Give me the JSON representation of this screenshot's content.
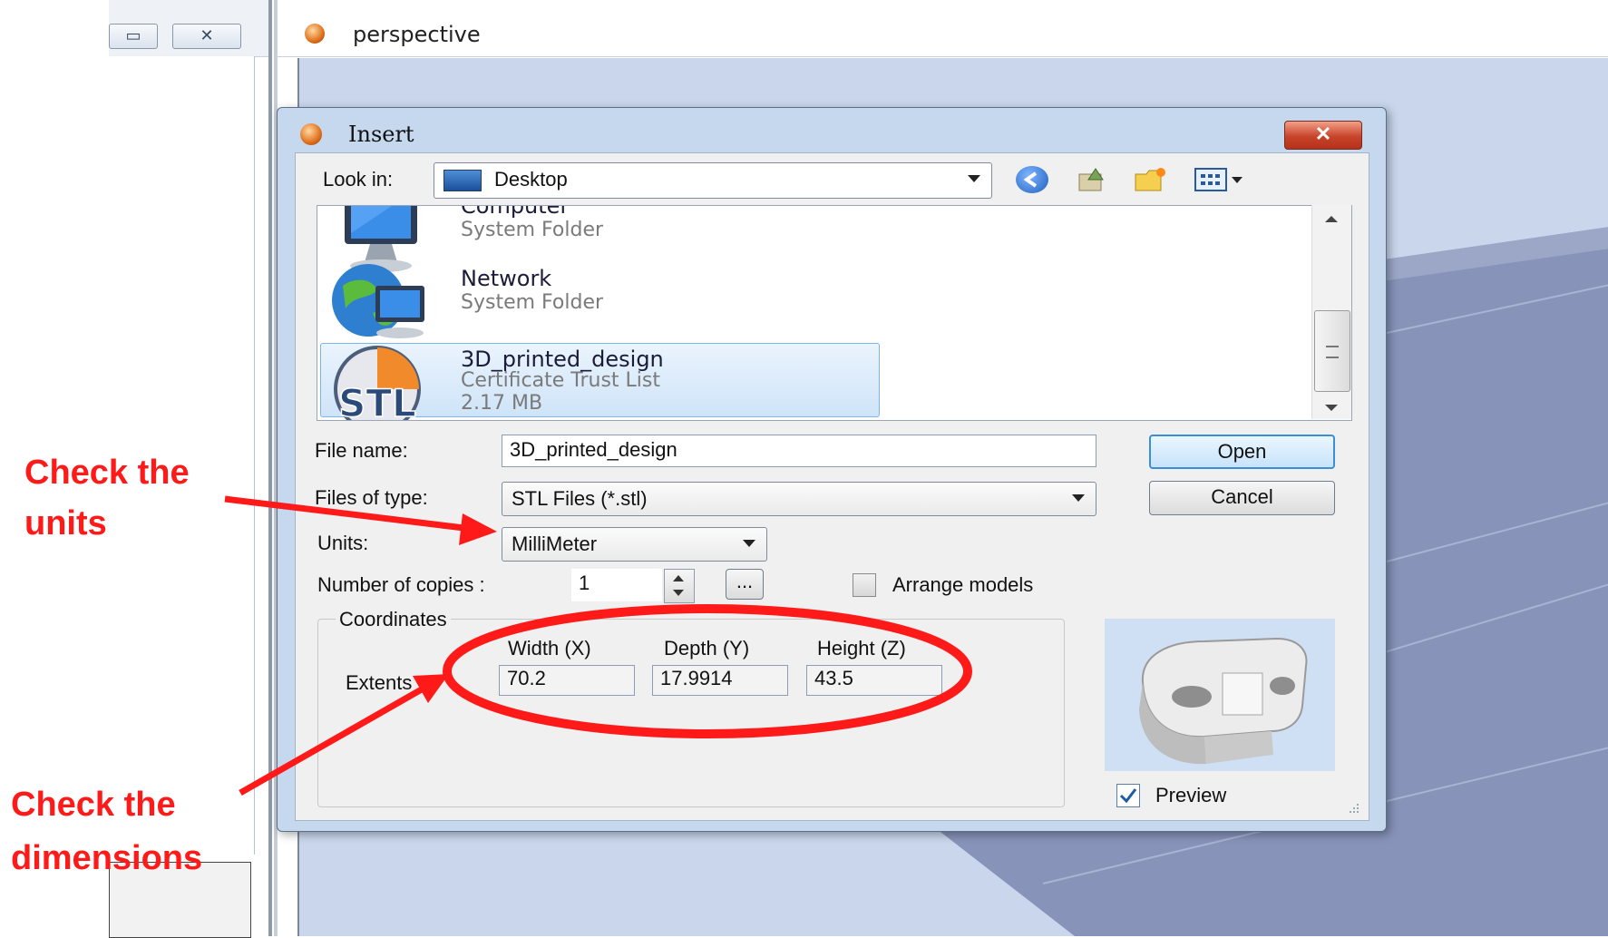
{
  "viewport": {
    "title": "perspective"
  },
  "left_window": {
    "restore_glyph": "▭",
    "close_glyph": "✕"
  },
  "dialog": {
    "title": "Insert",
    "close_glyph": "✕",
    "look_in_label": "Look in:",
    "look_in_value": "Desktop",
    "files": [
      {
        "name": "Computer",
        "type": "System Folder",
        "size": "",
        "icon": "computer-icon"
      },
      {
        "name": "Network",
        "type": "System Folder",
        "size": "",
        "icon": "network-globe-icon"
      },
      {
        "name": "3D_printed_design",
        "type": "Certificate Trust List",
        "size": "2.17 MB",
        "icon": "stl-file-icon",
        "selected": true
      }
    ],
    "file_name_label": "File name:",
    "file_name_value": "3D_printed_design",
    "files_of_type_label": "Files of type:",
    "files_of_type_value": "STL Files (*.stl)",
    "units_label": "Units:",
    "units_value": "MilliMeter",
    "copies_label": "Number of copies :",
    "copies_value": "1",
    "browse_label": "...",
    "arrange_label": "Arrange models",
    "arrange_checked": false,
    "open_label": "Open",
    "cancel_label": "Cancel",
    "coordinates": {
      "group_label": "Coordinates",
      "extents_label": "Extents",
      "width_label": "Width (X)",
      "depth_label": "Depth (Y)",
      "height_label": "Height (Z)",
      "width_value": "70.2",
      "depth_value": "17.9914",
      "height_value": "43.5"
    },
    "preview_label": "Preview",
    "preview_checked": true
  },
  "annotations": {
    "units_line1": "Check the",
    "units_line2": "units",
    "dims_line1": "Check the",
    "dims_line2": "dimensions",
    "color": "#ff1a1a"
  }
}
